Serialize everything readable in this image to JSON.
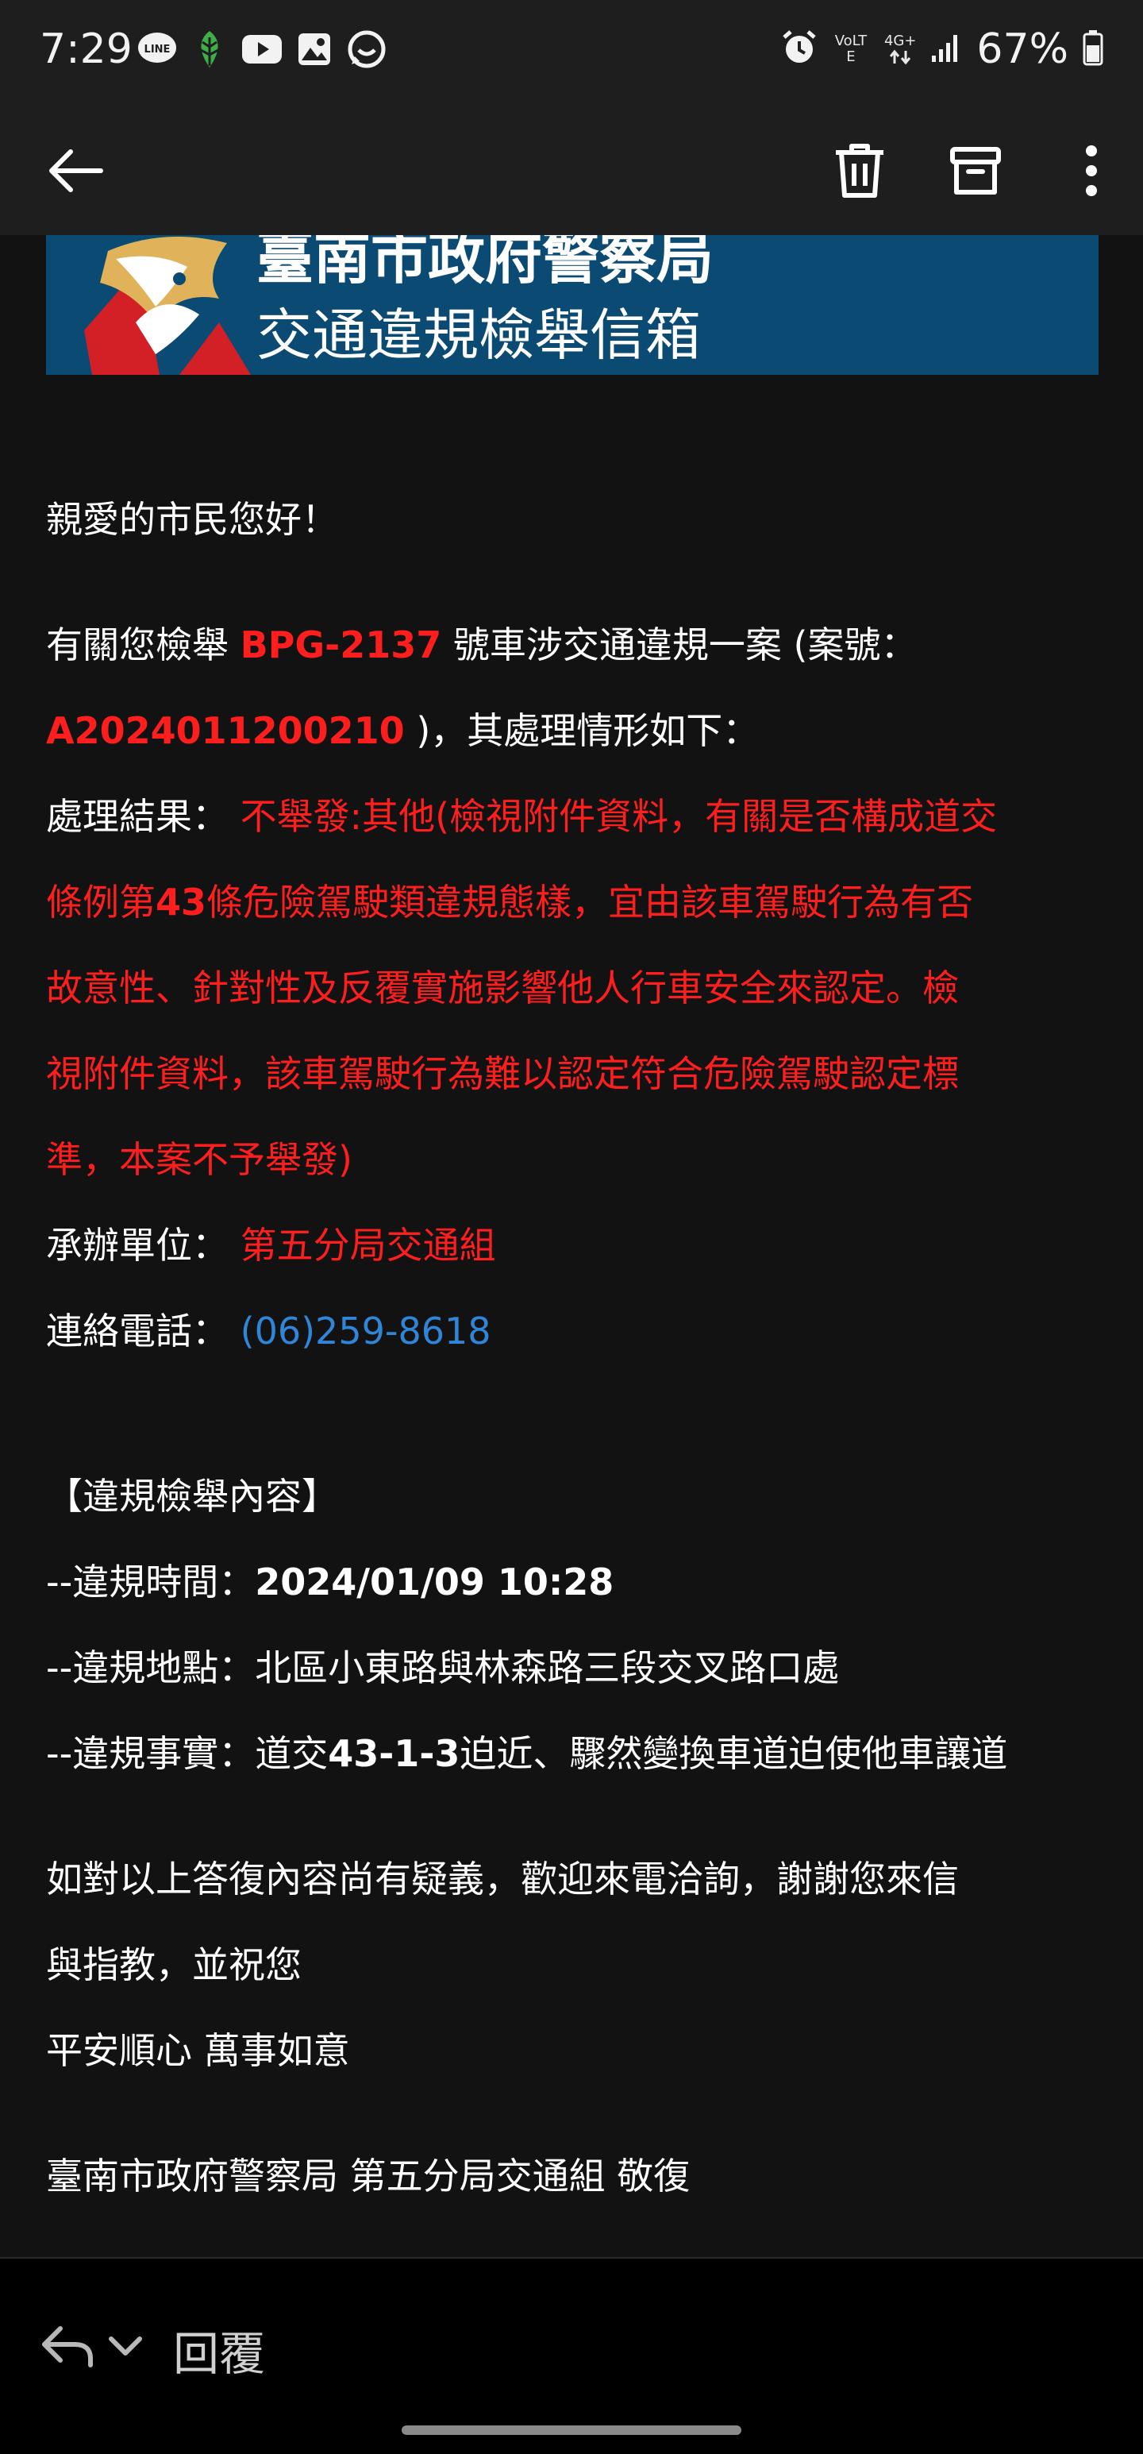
{
  "status_bar": {
    "time": "7:29",
    "notification_icons": [
      "line-icon",
      "leaf-app-icon",
      "youtube-icon",
      "gallery-icon",
      "chat-bubble-icon"
    ],
    "volte_label": "VoLTE",
    "network_label": "4G+",
    "battery_percent": "67%"
  },
  "app_bar": {
    "icons": [
      "back-arrow-icon",
      "trash-icon",
      "archive-icon",
      "more-vert-icon"
    ]
  },
  "banner": {
    "line1": "臺南市政府警察局",
    "line2": "交通違規檢舉信箱",
    "colors": {
      "background": "#0b4a73",
      "logo_red": "#d32027",
      "logo_gold": "#e0b25a"
    }
  },
  "email": {
    "greeting": "親愛的市民您好！",
    "intro_pre": "有關您檢舉 ",
    "plate": "BPG-2137",
    "intro_mid": " 號車涉交通違規一案 (案號：",
    "case_no": "A2024011200210",
    "intro_post": " )，其處理情形如下：",
    "result_label": "處理結果：",
    "result_lead": " 不舉發:其他(檢視附件資料，有關是否構成道交",
    "result_l2a": "條例第",
    "result_l2b": "43",
    "result_l2c": "條危險駕駛類違規態樣，宜由該車駕駛行為有否",
    "result_l3": "故意性、針對性及反覆實施影響他人行車安全來認定。檢",
    "result_l4": "視附件資料，該車駕駛行為難以認定符合危險駕駛認定標",
    "result_l5": "準，本案不予舉發)",
    "unit_label": "承辦單位：",
    "unit_value": " 第五分局交通組",
    "phone_label": "連絡電話：",
    "phone_value": " (06)259-8618",
    "section_title": "【違規檢舉內容】",
    "time_label": "--違規時間：",
    "time_value": "2024/01/09 10:28",
    "place_label": "--違規地點：",
    "place_value": "北區小東路與林森路三段交叉路口處",
    "fact_label": "--違規事實：",
    "fact_pre": "道交",
    "fact_code": "43-1-3",
    "fact_post": "迫近、驟然變換車道迫使他車讓道",
    "closing_l1": "如對以上答復內容尚有疑義，歡迎來電洽詢，謝謝您來信",
    "closing_l2": "與指教，並祝您",
    "closing_l3": "平安順心 萬事如意",
    "signature": "臺南市政府警察局 第五分局交通組 敬復",
    "colors": {
      "highlight_red": "#ff1e1e",
      "phone_blue": "#2f86d8"
    }
  },
  "bottom_bar": {
    "reply_label": "回覆"
  }
}
